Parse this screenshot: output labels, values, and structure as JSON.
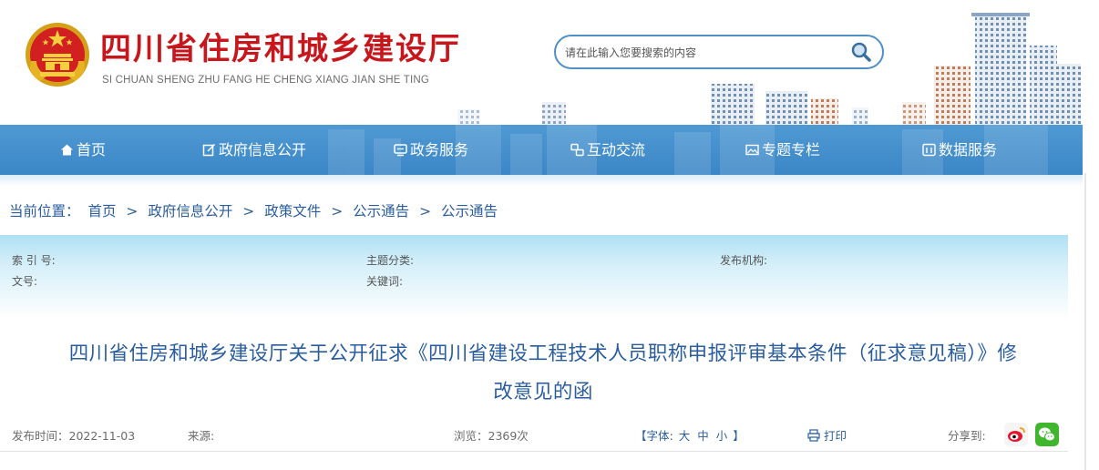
{
  "header": {
    "site_title": "四川省住房和城乡建设厅",
    "site_subtitle": "SI CHUAN SHENG ZHU FANG HE CHENG XIANG JIAN SHE TING",
    "emblem_icon": "national-emblem-icon",
    "search": {
      "placeholder": "请在此输入您要搜索的内容",
      "icon": "search-icon"
    }
  },
  "nav": {
    "items": [
      {
        "label": "首页",
        "icon": "home-icon"
      },
      {
        "label": "政府信息公开",
        "icon": "edit-icon"
      },
      {
        "label": "政务服务",
        "icon": "monitor-icon"
      },
      {
        "label": "互动交流",
        "icon": "exchange-icon"
      },
      {
        "label": "专题专栏",
        "icon": "image-icon"
      },
      {
        "label": "数据服务",
        "icon": "database-icon"
      }
    ]
  },
  "breadcrumb": {
    "prefix": "当前位置：",
    "items": [
      "首页",
      "政府信息公开",
      "政策文件",
      "公示通告",
      "公示通告"
    ],
    "separator": ">"
  },
  "meta": {
    "index_no_label": "索 引 号:",
    "doc_no_label": "文号:",
    "topic_label": "主题分类:",
    "keywords_label": "关键词:",
    "publisher_label": "发布机构:"
  },
  "article": {
    "title_line1": "四川省住房和城乡建设厅关于公开征求《四川省建设工程技术人员职称申报评审基本条件（征求意见稿）》修",
    "title_line2": "改意见的函"
  },
  "info": {
    "publish_time": "发布时间：2022-11-03",
    "source": "来源:",
    "views": "浏览：2369次",
    "font_prefix": "【字体:",
    "font_large": "大",
    "font_medium": "中",
    "font_small": "小",
    "font_suffix": "】",
    "print": "打印",
    "share_to": "分享到:",
    "weibo_icon": "weibo-icon",
    "wechat_icon": "wechat-icon"
  },
  "colors": {
    "brand_red": "#c8161d",
    "nav_blue": "#3b86c6",
    "link_blue": "#2a5d9f",
    "meta_bg": "#aee0f3"
  }
}
